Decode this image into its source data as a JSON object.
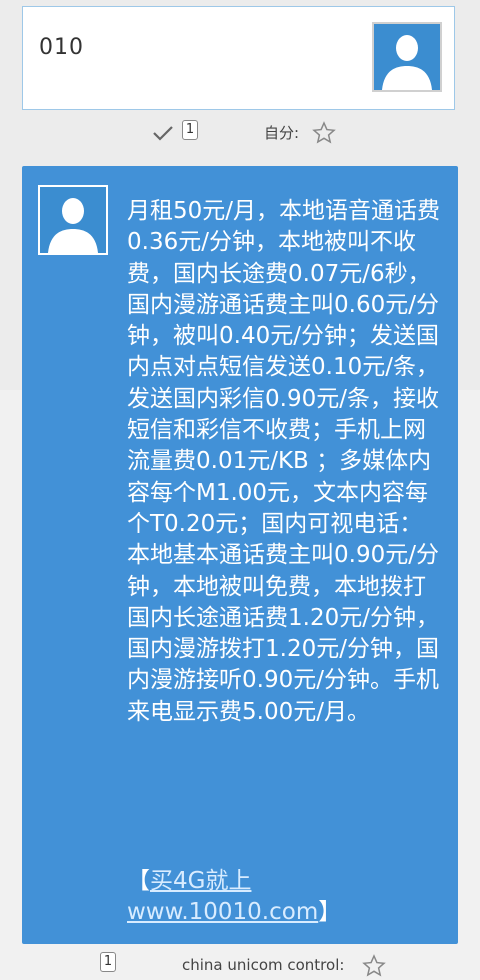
{
  "sent": {
    "text": "010",
    "badge": "1",
    "sender_label": "自分:"
  },
  "received": {
    "body": "月租50元/月，本地语音通话费0.36元/分钟，本地被叫不收费，国内长途费0.07元/6秒，国内漫游通话费主叫0.60元/分钟，被叫0.40元/分钟；发送国内点对点短信发送0.10元/条，发送国内彩信0.90元/条，接收短信和彩信不收费；手机上网流量费0.01元/KB ；多媒体内容每个M1.00元，文本内容每个T0.20元；国内可视电话：本地基本通话费主叫0.90元/分钟，本地被叫免费，本地拨打国内长途通话费1.20元/分钟，国内漫游拨打1.20元/分钟，国内漫游接听0.90元/分钟。手机来电显示费5.00元/月。",
    "link_open": "【",
    "link_text": "买4G就上www.10010.com",
    "link_close": "】",
    "badge": "1",
    "sender_label": "china unicom control:"
  },
  "icons": {
    "avatar": "person-avatar-icon",
    "check": "checkmark-icon",
    "star": "star-outline-icon"
  },
  "colors": {
    "bubble_blue": "#4291d7",
    "avatar_blue": "#3b8dd0",
    "background": "#ececec"
  }
}
